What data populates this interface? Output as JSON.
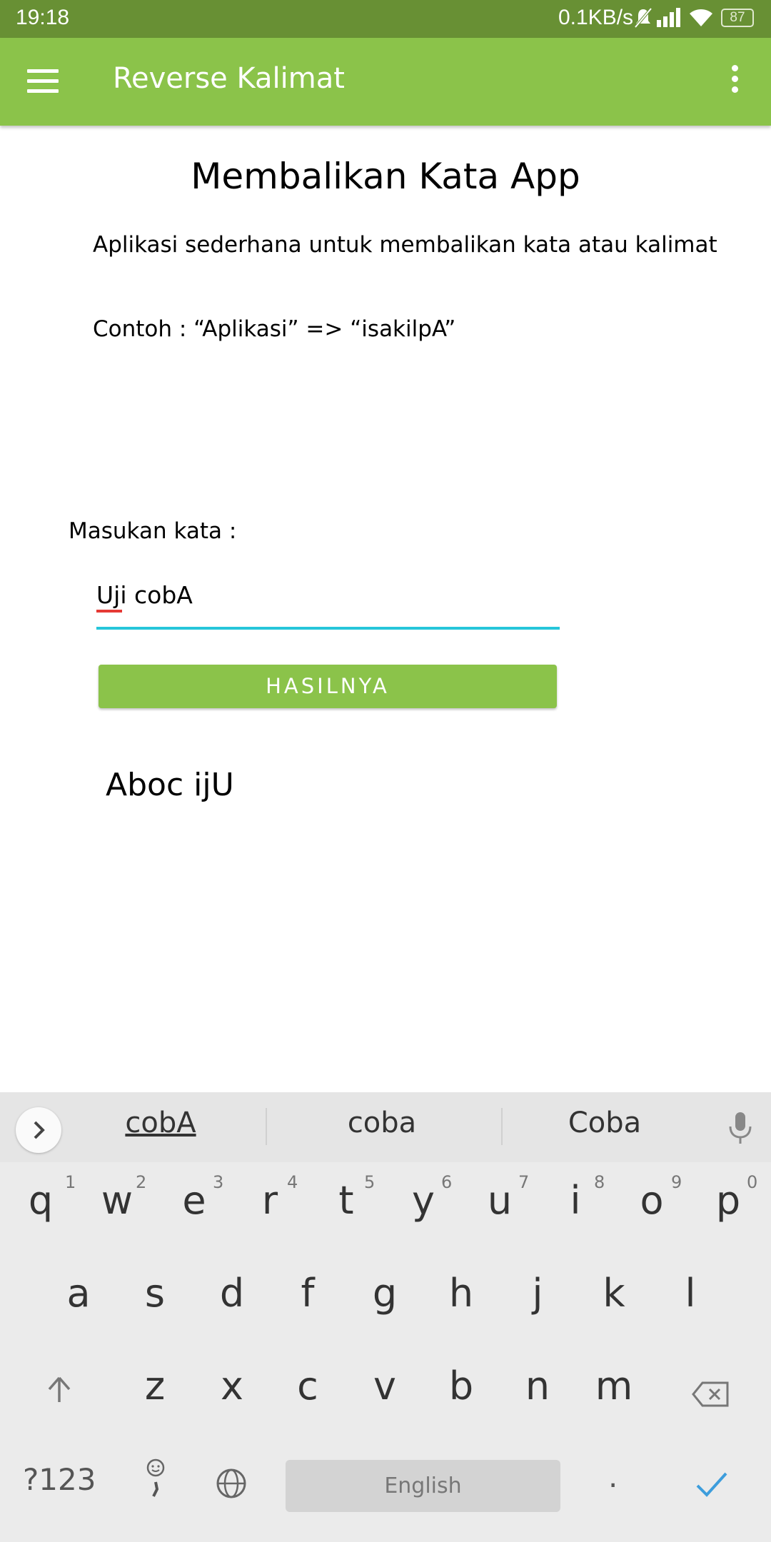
{
  "status_bar": {
    "time": "19:18",
    "net_speed": "0.1KB/s",
    "battery": "87"
  },
  "app_bar": {
    "title": "Reverse Kalimat",
    "menu_icon": "hamburger-menu-icon",
    "overflow_icon": "more-vert-icon",
    "color": "#8bc34a"
  },
  "main": {
    "heading": "Membalikan Kata App",
    "description": "Aplikasi sederhana untuk membalikan kata atau kalimat",
    "example": "Contoh : “Aplikasi” => “isakilpA”",
    "input_label": "Masukan kata :",
    "input_value": "Uji cobA",
    "button_label": "HASILNYA",
    "result": "Aboc ijU"
  },
  "keyboard": {
    "suggestions": [
      "cobA",
      "coba",
      "Coba"
    ],
    "row1": [
      {
        "key": "q",
        "hint": "1"
      },
      {
        "key": "w",
        "hint": "2"
      },
      {
        "key": "e",
        "hint": "3"
      },
      {
        "key": "r",
        "hint": "4"
      },
      {
        "key": "t",
        "hint": "5"
      },
      {
        "key": "y",
        "hint": "6"
      },
      {
        "key": "u",
        "hint": "7"
      },
      {
        "key": "i",
        "hint": "8"
      },
      {
        "key": "o",
        "hint": "9"
      },
      {
        "key": "p",
        "hint": "0"
      }
    ],
    "row2": [
      "a",
      "s",
      "d",
      "f",
      "g",
      "h",
      "j",
      "k",
      "l"
    ],
    "row3": [
      "z",
      "x",
      "c",
      "v",
      "b",
      "n",
      "m"
    ],
    "symbols_label": "?123",
    "space_label": "English",
    "period_label": "."
  }
}
